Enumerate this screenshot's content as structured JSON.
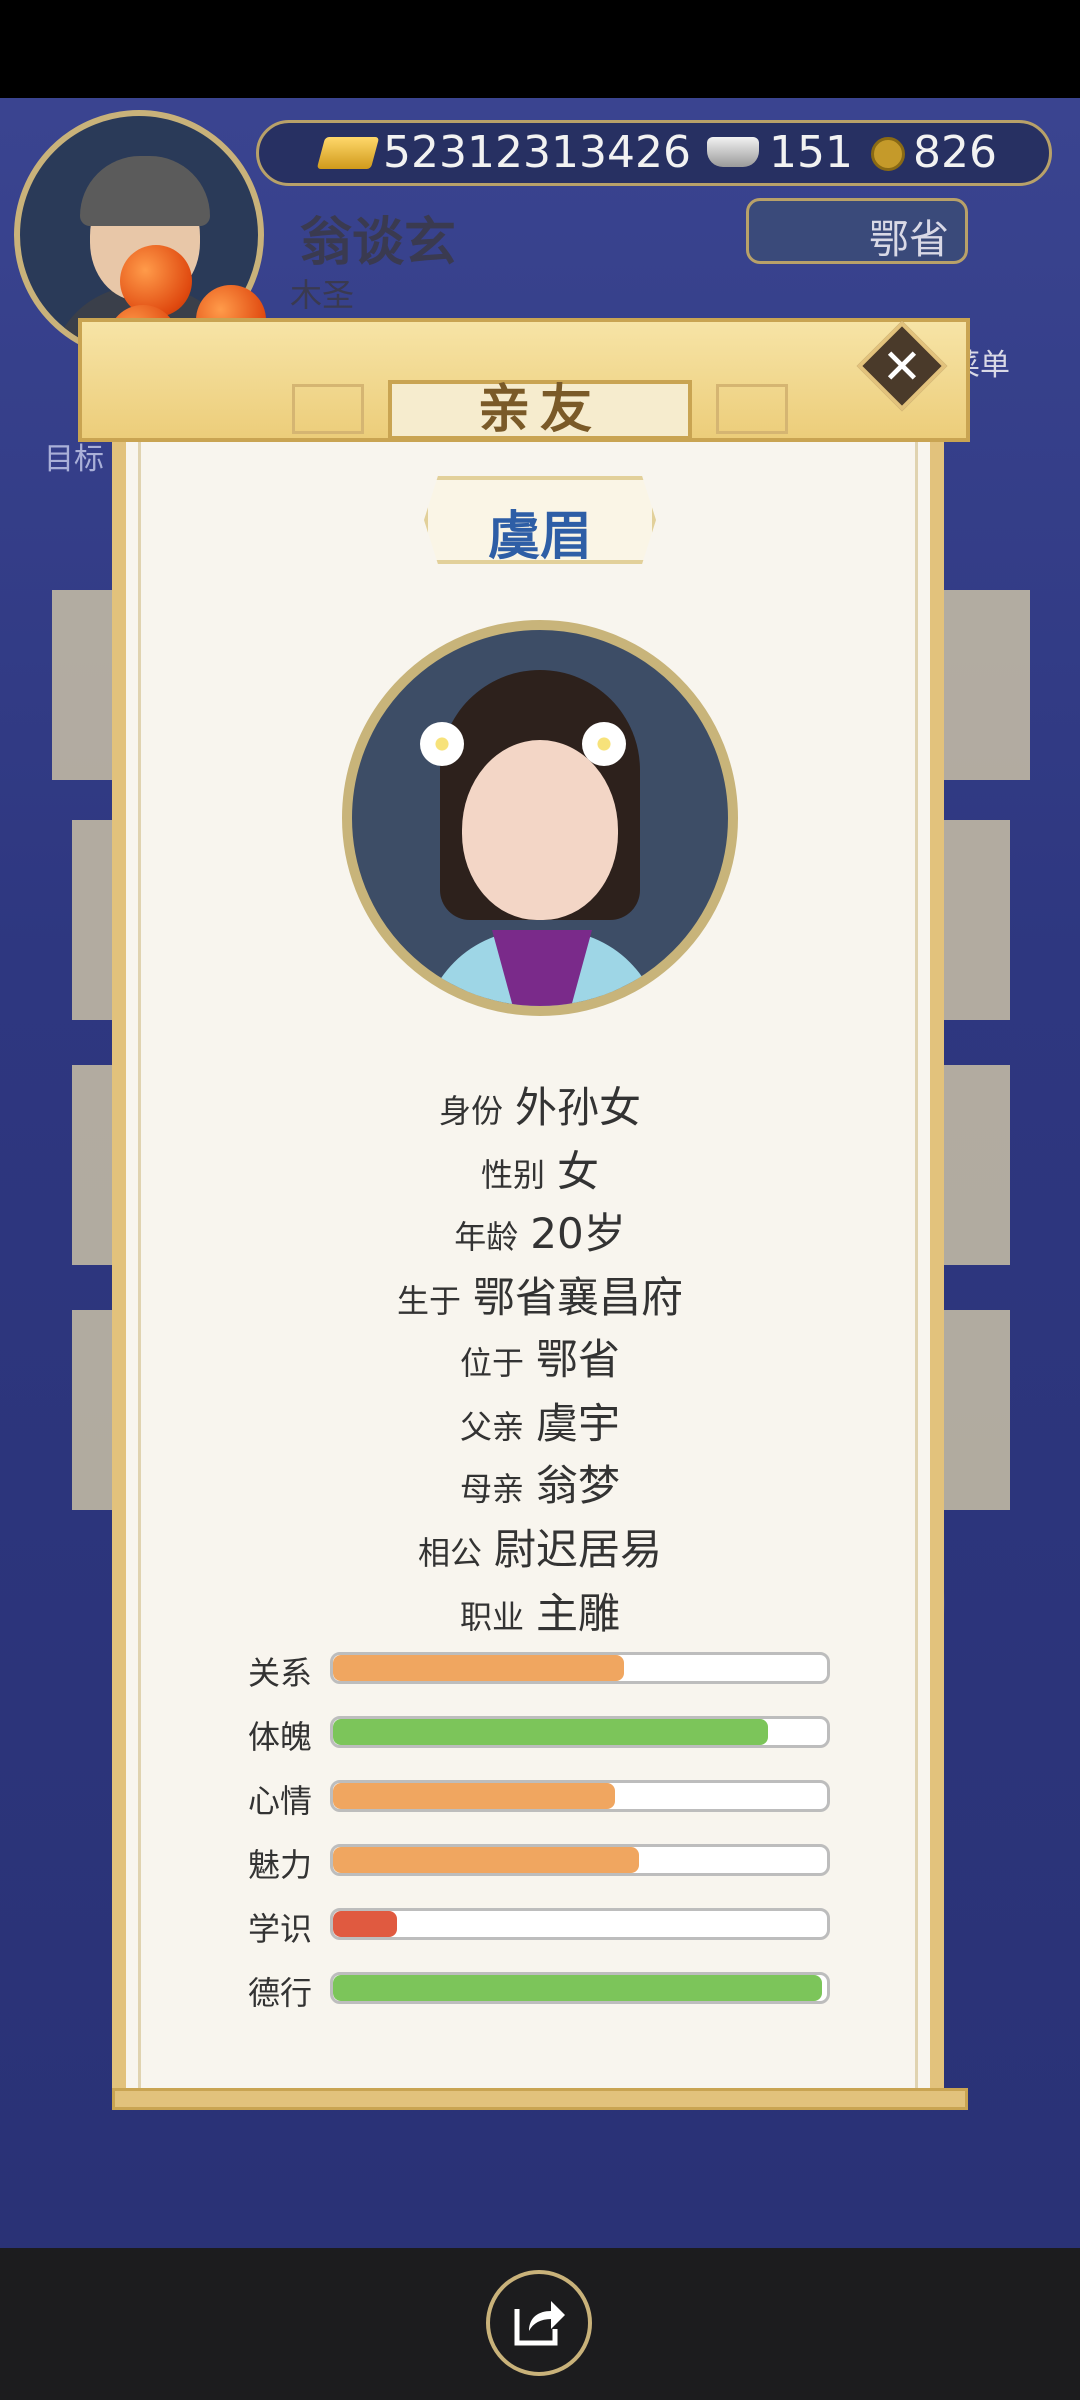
{
  "header": {
    "gold": "52312313426",
    "silver": "151",
    "coins": "826",
    "player_name": "翁谈玄",
    "player_title": "木圣",
    "province_button": "鄂省",
    "goal_label": "目标",
    "list_label": "菜单"
  },
  "modal": {
    "title": "亲友",
    "character_name": "虞眉",
    "info": [
      {
        "label": "身份",
        "value": "外孙女"
      },
      {
        "label": "性别",
        "value": "女"
      },
      {
        "label": "年龄",
        "value": "20岁"
      },
      {
        "label": "生于",
        "value": "鄂省襄昌府"
      },
      {
        "label": "位于",
        "value": "鄂省"
      },
      {
        "label": "父亲",
        "value": "虞宇"
      },
      {
        "label": "母亲",
        "value": "翁梦"
      },
      {
        "label": "相公",
        "value": "尉迟居易"
      },
      {
        "label": "职业",
        "value": "主雕"
      }
    ],
    "stats": [
      {
        "label": "关系",
        "value": 0.59,
        "color": "#f0a660"
      },
      {
        "label": "体魄",
        "value": 0.88,
        "color": "#7cc55a"
      },
      {
        "label": "心情",
        "value": 0.57,
        "color": "#f0a660"
      },
      {
        "label": "魅力",
        "value": 0.62,
        "color": "#f0a660"
      },
      {
        "label": "学识",
        "value": 0.13,
        "color": "#e05a40"
      },
      {
        "label": "德行",
        "value": 0.99,
        "color": "#7cc55a"
      }
    ]
  },
  "icons": [
    "close-icon",
    "share-icon",
    "gold-ingot-icon",
    "silver-ingot-icon",
    "coin-icon"
  ]
}
